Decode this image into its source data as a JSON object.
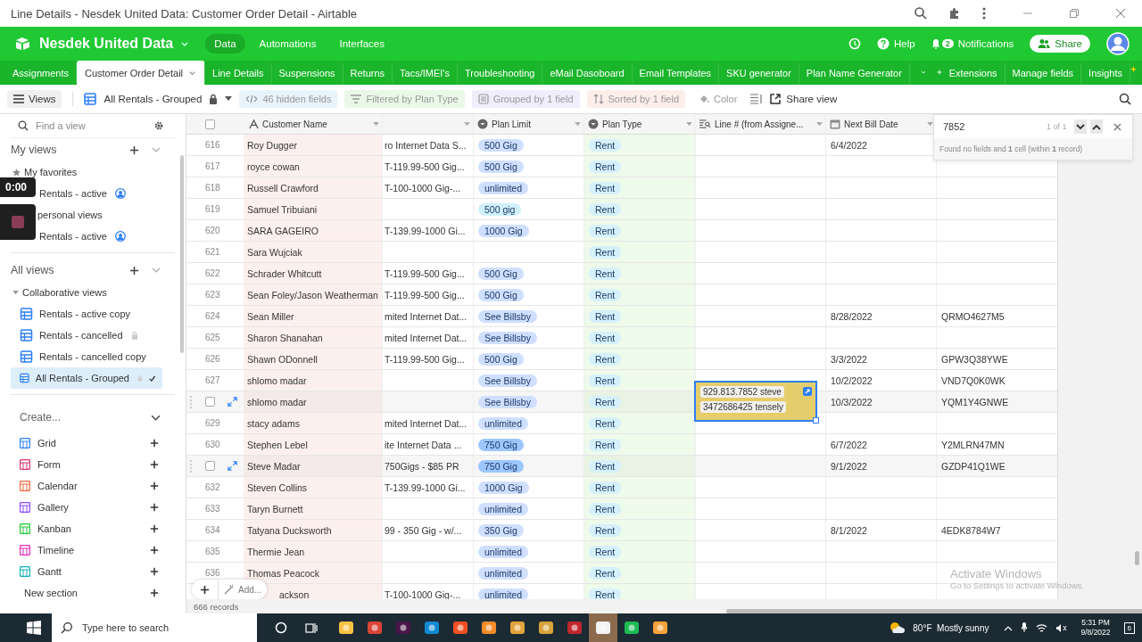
{
  "browser": {
    "title": "Line Details - Nesdek United Data: Customer Order Detail - Airtable"
  },
  "base": {
    "name": "Nesdek United Data",
    "nav": [
      {
        "label": "Data",
        "selected": true
      },
      {
        "label": "Automations",
        "selected": false
      },
      {
        "label": "Interfaces",
        "selected": false
      }
    ],
    "help": "Help",
    "notification_count": "2",
    "notifications": "Notifications",
    "share": "Share"
  },
  "tables": {
    "tabs": [
      {
        "label": "Assignments",
        "selected": false
      },
      {
        "label": "Customer Order Detail",
        "selected": true
      },
      {
        "label": "Line Details",
        "selected": false
      },
      {
        "label": "Suspensions",
        "selected": false
      },
      {
        "label": "Returns",
        "selected": false
      },
      {
        "label": "Tacs/IMEI's",
        "selected": false
      },
      {
        "label": "Troubleshooting",
        "selected": false
      },
      {
        "label": "eMail Dasoboard",
        "selected": false
      },
      {
        "label": "Email Templates",
        "selected": false
      },
      {
        "label": "SKU generator",
        "selected": false
      },
      {
        "label": "Plan Name Generator",
        "selected": false
      }
    ],
    "right": [
      "Extensions",
      "Manage fields",
      "Insights"
    ]
  },
  "toolbar": {
    "views": "Views",
    "current_view": "All Rentals - Grouped",
    "hidden": "46 hidden fields",
    "filter": "Filtered by Plan Type",
    "group": "Grouped by 1 field",
    "sort": "Sorted by 1 field",
    "color_label": "Color",
    "share_view": "Share view"
  },
  "sidebar": {
    "search_placeholder": "Find a view",
    "sections": [
      {
        "title": "My views",
        "items": [
          {
            "kind": "favorites",
            "label": "My favorites"
          },
          {
            "kind": "personal",
            "label": "Rentals - active",
            "locked": false,
            "selected": false
          },
          {
            "kind": "partial",
            "label": "personal views"
          },
          {
            "kind": "personal",
            "label": "Rentals - active",
            "locked": false,
            "selected": false
          }
        ]
      },
      {
        "title": "All views",
        "items": [
          {
            "kind": "group",
            "label": "Collaborative views"
          },
          {
            "kind": "view",
            "label": "Rentals - active copy",
            "locked": false,
            "selected": false
          },
          {
            "kind": "view",
            "label": "Rentals - cancelled",
            "locked": true,
            "selected": false
          },
          {
            "kind": "view",
            "label": "Rentals - cancelled copy",
            "locked": false,
            "selected": false
          },
          {
            "kind": "view",
            "label": "All Rentals - Grouped",
            "locked": true,
            "selected": true
          }
        ]
      }
    ],
    "create": {
      "title": "Create...",
      "items": [
        {
          "kind": "grid",
          "label": "Grid"
        },
        {
          "kind": "form",
          "label": "Form"
        },
        {
          "kind": "calendar",
          "label": "Calendar"
        },
        {
          "kind": "gallery",
          "label": "Gallery"
        },
        {
          "kind": "kanban",
          "label": "Kanban"
        },
        {
          "kind": "timeline",
          "label": "Timeline"
        },
        {
          "kind": "gantt",
          "label": "Gantt"
        },
        {
          "kind": "section",
          "label": "New section"
        }
      ]
    }
  },
  "recorder": {
    "time": "0:00"
  },
  "grid": {
    "all_checked": false,
    "columns": [
      {
        "kind": "text",
        "title": "Customer Name"
      },
      {
        "kind": "blank"
      },
      {
        "kind": "select",
        "title": "Plan Limit"
      },
      {
        "kind": "select",
        "title": "Plan Type"
      },
      {
        "kind": "lookup",
        "title": "Line # (from Assigne..."
      },
      {
        "kind": "date",
        "title": "Next Bill Date"
      }
    ],
    "rows": [
      {
        "kind": "number",
        "num": "616",
        "name": "Roy Dugger",
        "plan": "ro Internet Data S...",
        "plan_limit": {
          "label": "500 Gig",
          "color": "#cfdfff"
        },
        "plan_type": "Rent",
        "bill_date": "6/4/2022"
      },
      {
        "kind": "number",
        "num": "617",
        "name": "royce cowan",
        "plan": "T-119.99-500 Gig...",
        "plan_limit": {
          "label": "500 Gig",
          "color": "#cfdfff"
        },
        "plan_type": "Rent"
      },
      {
        "kind": "number",
        "num": "618",
        "name": "Russell Crawford",
        "plan": "T-100-1000 Gig-...",
        "plan_limit": {
          "label": "unlimited",
          "color": "#cfdfff"
        },
        "plan_type": "Rent"
      },
      {
        "kind": "number",
        "num": "619",
        "name": "Samuel Tribuiani",
        "plan_limit": {
          "label": "500 gig",
          "color": "#d0f0fd"
        },
        "plan_type": "Rent"
      },
      {
        "kind": "number",
        "num": "620",
        "name": "SARA GAGEIRO",
        "plan": "T-139.99-1000 Gi...",
        "plan_limit": {
          "label": "1000 Gig",
          "color": "#cfdfff"
        },
        "plan_type": "Rent"
      },
      {
        "kind": "number",
        "num": "621",
        "name": "Sara Wujciak",
        "plan_type": "Rent"
      },
      {
        "kind": "number",
        "num": "622",
        "name": "Schrader Whitcutt",
        "plan": "T-119.99-500 Gig...",
        "plan_limit": {
          "label": "500 Gig",
          "color": "#cfdfff"
        },
        "plan_type": "Rent"
      },
      {
        "kind": "number",
        "num": "623",
        "name": "Sean Foley/Jason Weatherman",
        "plan": "T-119.99-500 Gig...",
        "plan_limit": {
          "label": "500 Gig",
          "color": "#cfdfff"
        },
        "plan_type": "Rent"
      },
      {
        "kind": "number",
        "num": "624",
        "name": "Sean Miller",
        "plan": "mited Internet Dat...",
        "plan_limit": {
          "label": "See Billsby",
          "color": "#cfdfff"
        },
        "plan_type": "Rent",
        "bill_date": "8/28/2022",
        "code": "QRMO4627M5"
      },
      {
        "kind": "number",
        "num": "625",
        "name": "Sharon Shanahan",
        "plan": "mited Internet Dat...",
        "plan_limit": {
          "label": "See Billsby",
          "color": "#cfdfff"
        },
        "plan_type": "Rent"
      },
      {
        "kind": "number",
        "num": "626",
        "name": "Shawn ODonnell",
        "plan": "T-119.99-500 Gig...",
        "plan_limit": {
          "label": "500 Gig",
          "color": "#cfdfff"
        },
        "plan_type": "Rent",
        "bill_date": "3/3/2022",
        "code": "GPW3Q38YWE"
      },
      {
        "kind": "number",
        "num": "627",
        "name": "shlomo madar",
        "plan_limit": {
          "label": "See Billsby",
          "color": "#cfdfff"
        },
        "plan_type": "Rent",
        "bill_date": "10/2/2022",
        "code": "VND7Q0K0WK"
      },
      {
        "kind": "hover",
        "checked": false,
        "name": "shlomo madar",
        "plan_limit": {
          "label": "See Billsby",
          "color": "#cfdfff"
        },
        "plan_type": "Rent",
        "line": [
          "929.813.7852 steve",
          "3472686425 tensely"
        ],
        "bill_date": "10/3/2022",
        "code": "YQM1Y4GNWE"
      },
      {
        "kind": "number",
        "num": "629",
        "name": "stacy adams",
        "plan": "mited Internet Dat...",
        "plan_limit": {
          "label": "unlimited",
          "color": "#cfdfff"
        },
        "plan_type": "Rent"
      },
      {
        "kind": "number",
        "num": "630",
        "name": "Stephen Lebel",
        "plan": "ite Internet Data ...",
        "plan_limit": {
          "label": "750 Gig",
          "color": "#9cc7ff"
        },
        "plan_type": "Rent",
        "bill_date": "6/7/2022",
        "code": "Y2MLRN47MN"
      },
      {
        "kind": "hover",
        "checked": false,
        "name": "Steve Madar",
        "plan": "750Gigs - $85 PR",
        "plan_limit": {
          "label": "750 Gig",
          "color": "#9cc7ff"
        },
        "plan_type": "Rent",
        "bill_date": "9/1/2022",
        "code": "GZDP41Q1WE"
      },
      {
        "kind": "number",
        "num": "632",
        "name": "Steven Collins",
        "plan": "T-139.99-1000 Gi...",
        "plan_limit": {
          "label": "1000 Gig",
          "color": "#cfdfff"
        },
        "plan_type": "Rent"
      },
      {
        "kind": "number",
        "num": "633",
        "name": "Taryn Burnett",
        "plan_limit": {
          "label": "unlimited",
          "color": "#cfdfff"
        },
        "plan_type": "Rent"
      },
      {
        "kind": "number",
        "num": "634",
        "name": "Tatyana Ducksworth",
        "plan": "99 - 350 Gig - w/...",
        "plan_limit": {
          "label": "350 Gig",
          "color": "#cfdfff"
        },
        "plan_type": "Rent",
        "bill_date": "8/1/2022",
        "code": "4EDK8784W7"
      },
      {
        "kind": "number",
        "num": "635",
        "name": "Thermie Jean",
        "plan_limit": {
          "label": "unlimited",
          "color": "#cfdfff"
        },
        "plan_type": "Rent"
      },
      {
        "kind": "number",
        "num": "636",
        "name": "Thomas Peacock",
        "plan_limit": {
          "label": "unlimited",
          "color": "#cfdfff"
        },
        "plan_type": "Rent"
      },
      {
        "kind": "covered",
        "name": "ackson",
        "plan": "T-100-1000 Gig-...",
        "plan_limit": {
          "label": "unlimited",
          "color": "#cfdfff"
        },
        "plan_type": "Rent"
      }
    ],
    "add": "Add...",
    "records": "666 records"
  },
  "search": {
    "value": "7852",
    "count": "1 of 1",
    "result": "Found no fields and **1** cell (within **1** record)"
  },
  "os_notice": {
    "title": "Activate Windows",
    "subtitle": "Go to Settings to activate Windows."
  },
  "taskbar": {
    "search_placeholder": "Type here to search",
    "weather": "80°F  Mostly sunny",
    "time": "5:31 PM",
    "date": "9/8/2022",
    "notifications": "6"
  }
}
